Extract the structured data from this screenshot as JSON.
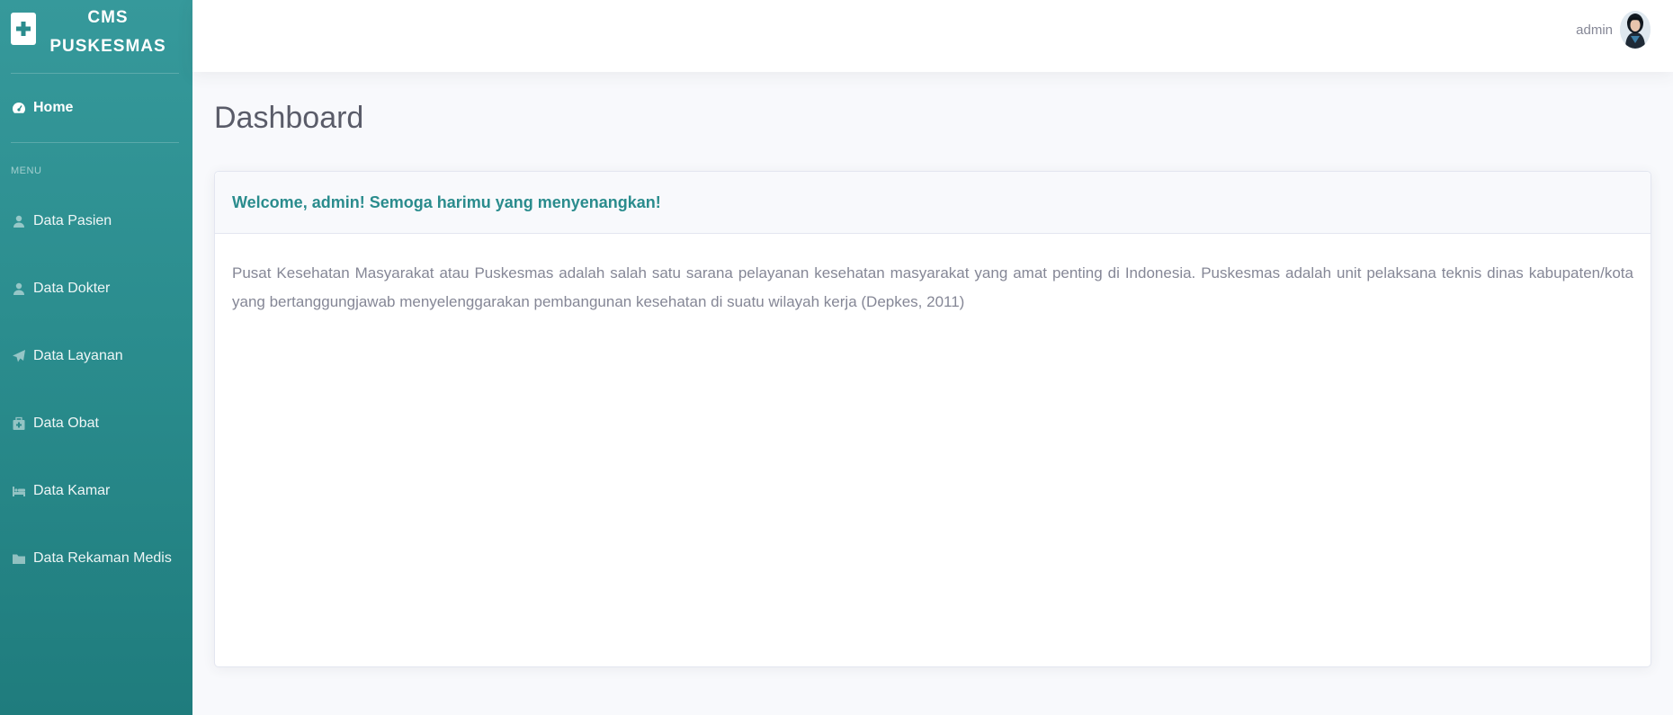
{
  "brand": {
    "line1": "CMS",
    "line2": "PUSKESMAS",
    "icon": "plus-icon"
  },
  "sidebar": {
    "home": {
      "label": "Home",
      "icon": "dashboard-icon"
    },
    "heading": "MENU",
    "items": [
      {
        "label": "Data Pasien",
        "icon": "user-icon"
      },
      {
        "label": "Data Dokter",
        "icon": "user-md-icon"
      },
      {
        "label": "Data Layanan",
        "icon": "paper-plane-icon"
      },
      {
        "label": "Data Obat",
        "icon": "medkit-icon"
      },
      {
        "label": "Data Kamar",
        "icon": "bed-icon"
      },
      {
        "label": "Data Rekaman Medis",
        "icon": "folder-icon"
      }
    ]
  },
  "topbar": {
    "user_name": "admin"
  },
  "main": {
    "title": "Dashboard",
    "card": {
      "header": "Welcome, admin! Semoga harimu yang menyenangkan!",
      "body": "Pusat Kesehatan Masyarakat atau Puskesmas adalah salah satu sarana pelayanan kesehatan masyarakat yang amat penting di Indonesia. Puskesmas adalah unit pelaksana teknis dinas kabupaten/kota yang bertanggungjawab menyelenggarakan pembangunan kesehatan di suatu wilayah kerja (Depkes, 2011)"
    }
  },
  "colors": {
    "sidebar": "#2a8c8d",
    "accent": "#2a8c8d",
    "background": "#f8f9fc"
  }
}
